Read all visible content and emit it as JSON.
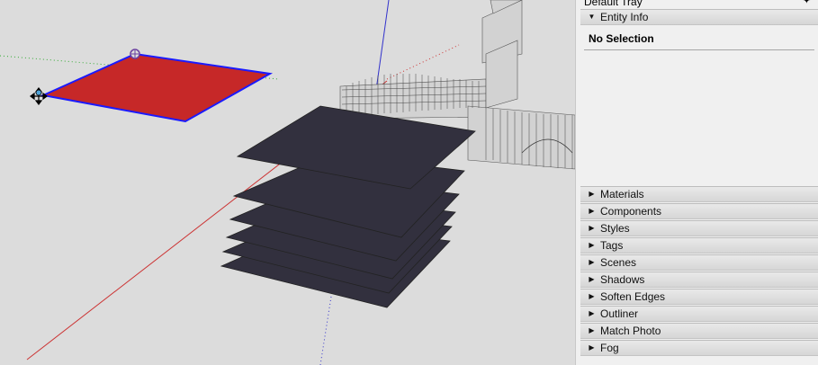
{
  "tray": {
    "title": "Default Tray",
    "pin_icon": "pin-icon"
  },
  "entity_info": {
    "label": "Entity Info",
    "expanded": true,
    "status": "No Selection"
  },
  "panels": [
    {
      "label": "Materials",
      "expanded": false
    },
    {
      "label": "Components",
      "expanded": false
    },
    {
      "label": "Styles",
      "expanded": false
    },
    {
      "label": "Tags",
      "expanded": false
    },
    {
      "label": "Scenes",
      "expanded": false
    },
    {
      "label": "Shadows",
      "expanded": false
    },
    {
      "label": "Soften Edges",
      "expanded": false
    },
    {
      "label": "Outliner",
      "expanded": false
    },
    {
      "label": "Match Photo",
      "expanded": false
    },
    {
      "label": "Fog",
      "expanded": false
    }
  ],
  "viewport": {
    "background": "#dcdcdc",
    "selected_face_color": "#c62828",
    "selected_edge_color": "#1a1aff",
    "stack_face_color": "#32303e",
    "axis_red": "#cc3333",
    "axis_green": "#33aa33",
    "axis_blue": "#3333cc"
  },
  "icons": {
    "collapsed_arrow": "▶",
    "expanded_arrow": "▼",
    "move_cursor": "move-cursor-icon",
    "rotate_grip": "rotate-grip-icon"
  }
}
